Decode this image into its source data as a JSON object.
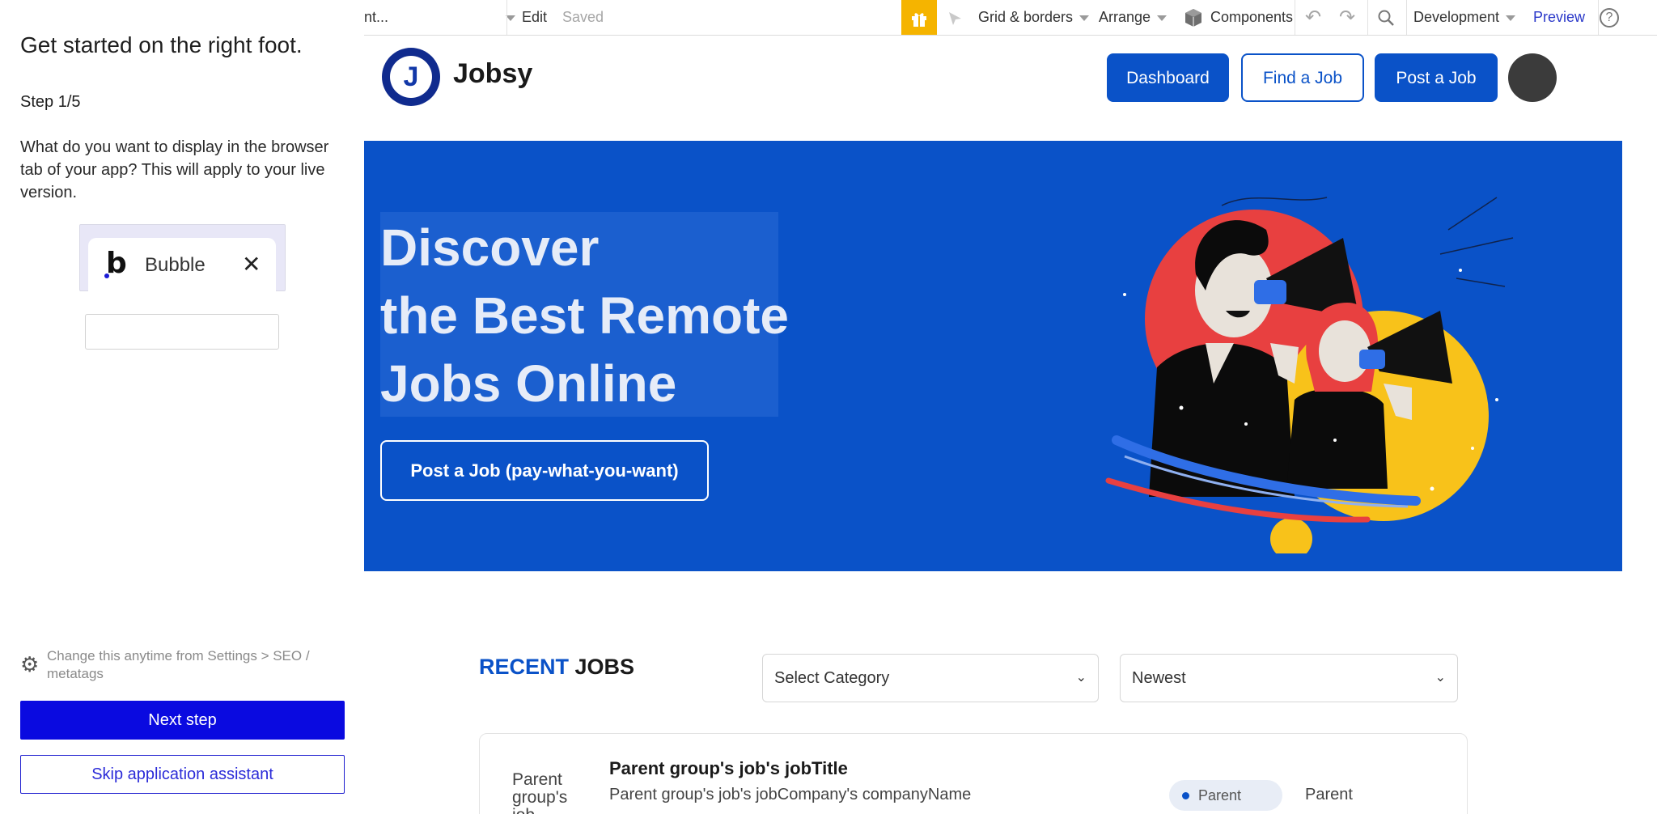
{
  "assistant": {
    "title": "Get started on the right foot.",
    "step": "Step 1/5",
    "description": "What do you want to display in the browser tab of your app? This will apply to your live version.",
    "tab_preview_label": "Bubble",
    "tab_close_glyph": "✕",
    "logo_glyph": "b",
    "settings_note": "Change this anytime from Settings > SEO / metatags",
    "next_button": "Next step",
    "skip_button": "Skip application assistant",
    "favicon_input_value": ""
  },
  "toolbar": {
    "page_selector": "nt...",
    "edit": "Edit",
    "saved": "Saved",
    "grid_borders": "Grid & borders",
    "arrange": "Arrange",
    "components": "Components",
    "development": "Development",
    "preview": "Preview",
    "gift_icon": "gift-icon",
    "help_glyph": "?"
  },
  "app": {
    "brand_name": "Jobsy",
    "logo_letter": "J",
    "nav": {
      "dashboard": "Dashboard",
      "find_job": "Find a Job",
      "post_job": "Post a Job"
    },
    "hero": {
      "headline_line1": "Discover",
      "headline_line2": "the Best Remote",
      "headline_line3": "Jobs Online",
      "cta": "Post a Job (pay-what-you-want)"
    },
    "recent": {
      "accent_word": "RECENT",
      "rest_word": "JOBS",
      "category_select": "Select Category",
      "sort_select": "Newest"
    },
    "job_card": {
      "thumb_text": "Parent group's job",
      "title": "Parent group's job's jobTitle",
      "company": "Parent group's job's jobCompany's companyName",
      "pill": "Parent",
      "right_text": "Parent"
    }
  },
  "colors": {
    "primary_blue": "#0a52c8",
    "assistant_blue": "#0a0ae0",
    "gift_yellow": "#f5b400"
  }
}
